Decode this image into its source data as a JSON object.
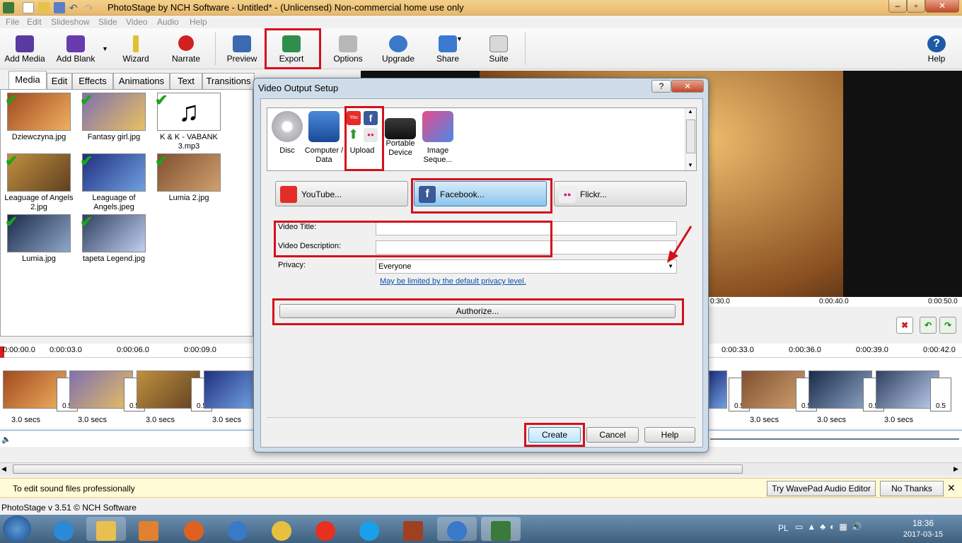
{
  "window": {
    "title": "PhotoStage by NCH Software - Untitled* - (Unlicensed) Non-commercial home use only"
  },
  "menu": [
    "File",
    "Edit",
    "Slideshow",
    "Slide",
    "Video",
    "Audio",
    "Help"
  ],
  "toolbar": {
    "add_media": "Add Media",
    "add_blank": "Add Blank",
    "wizard": "Wizard",
    "narrate": "Narrate",
    "preview": "Preview",
    "export": "Export",
    "options": "Options",
    "upgrade": "Upgrade",
    "share": "Share",
    "suite": "Suite",
    "help": "Help"
  },
  "tabs": [
    "Media",
    "Edit",
    "Effects",
    "Animations",
    "Text",
    "Transitions"
  ],
  "media": [
    {
      "name": "Dziewczyna.jpg"
    },
    {
      "name": "Fantasy girl.jpg"
    },
    {
      "name": "K & K - VABANK 3.mp3"
    },
    {
      "name": "Leaguage of Angels 2.jpg"
    },
    {
      "name": "Leaguage of Angels.jpeg"
    },
    {
      "name": "Lumia 2.jpg"
    },
    {
      "name": "Lumia.jpg"
    },
    {
      "name": "tapeta Legend.jpg"
    }
  ],
  "preview_ruler": [
    "0:30.0",
    "0:00:40.0",
    "0:00:50.0"
  ],
  "timeline": {
    "ruler": [
      "0:00:00.0",
      "0:00:03.0",
      "0:00:06.0",
      "0:00:09.0",
      "0:00:33.0",
      "0:00:36.0",
      "0:00:39.0",
      "0:00:42.0"
    ],
    "clip_duration": "3.0 secs",
    "transition": "0.5"
  },
  "dialog": {
    "title": "Video Output Setup",
    "help_btn": "?",
    "close_btn": "✕",
    "devices": [
      "Disc",
      "Computer / Data",
      "Upload",
      "Portable Device",
      "Image Seque..."
    ],
    "services": [
      "YouTube...",
      "Facebook...",
      "Flickr..."
    ],
    "video_title_label": "Video Title:",
    "video_title_value": "",
    "video_desc_label": "Video Description:",
    "video_desc_value": "",
    "privacy_label": "Privacy:",
    "privacy_value": "Everyone",
    "privacy_link": "May be limited by the default privacy level.",
    "authorize": "Authorize...",
    "create": "Create",
    "cancel": "Cancel",
    "help": "Help"
  },
  "notification": {
    "text": "To edit sound files professionally",
    "try": "Try WavePad Audio Editor",
    "no_thanks": "No Thanks"
  },
  "status": "PhotoStage v 3.51 © NCH Software",
  "taskbar": {
    "lang": "PL",
    "time": "18:36",
    "date": "2017-03-15"
  },
  "colors": {
    "highlight": "#d4101c",
    "facebook": "#3b5998",
    "youtube": "#e52d27",
    "link": "#0b4fa8"
  }
}
